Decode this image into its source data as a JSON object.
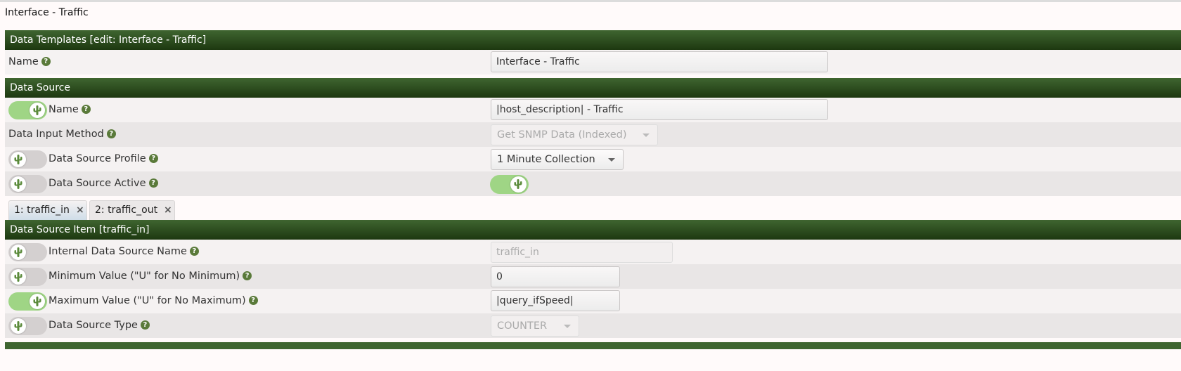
{
  "page": {
    "title": "Interface - Traffic"
  },
  "template_header": "Data Templates [edit: Interface - Traffic]",
  "template_name": {
    "label": "Name",
    "value": "Interface - Traffic"
  },
  "data_source_header": "Data Source",
  "ds_fields": {
    "name": {
      "label": "Name",
      "value": "|host_description| - Traffic",
      "override_on": true
    },
    "input_method": {
      "label": "Data Input Method",
      "value": "Get SNMP Data (Indexed)"
    },
    "profile": {
      "label": "Data Source Profile",
      "value": "1 Minute Collection",
      "override_on": false
    },
    "active": {
      "label": "Data Source Active",
      "override_on": false,
      "value_on": true
    }
  },
  "tabs": [
    {
      "label": "1: traffic_in",
      "close": "×",
      "active": true
    },
    {
      "label": "2: traffic_out",
      "close": "×",
      "active": false
    }
  ],
  "item_header": "Data Source Item [traffic_in]",
  "item_fields": {
    "internal_name": {
      "label": "Internal Data Source Name",
      "value": "traffic_in",
      "override_on": false
    },
    "min_value": {
      "label": "Minimum Value (\"U\" for No Minimum)",
      "value": "0",
      "override_on": false
    },
    "max_value": {
      "label": "Maximum Value (\"U\" for No Maximum)",
      "value": "|query_ifSpeed|",
      "override_on": true
    },
    "ds_type": {
      "label": "Data Source Type",
      "value": "COUNTER",
      "override_on": false
    }
  },
  "help_glyph": "?",
  "colors": {
    "header_green": "#2c4d1f",
    "toggle_on": "#9fd585",
    "toggle_off": "#d4d0d0",
    "tab_active": "#cfdde8"
  }
}
